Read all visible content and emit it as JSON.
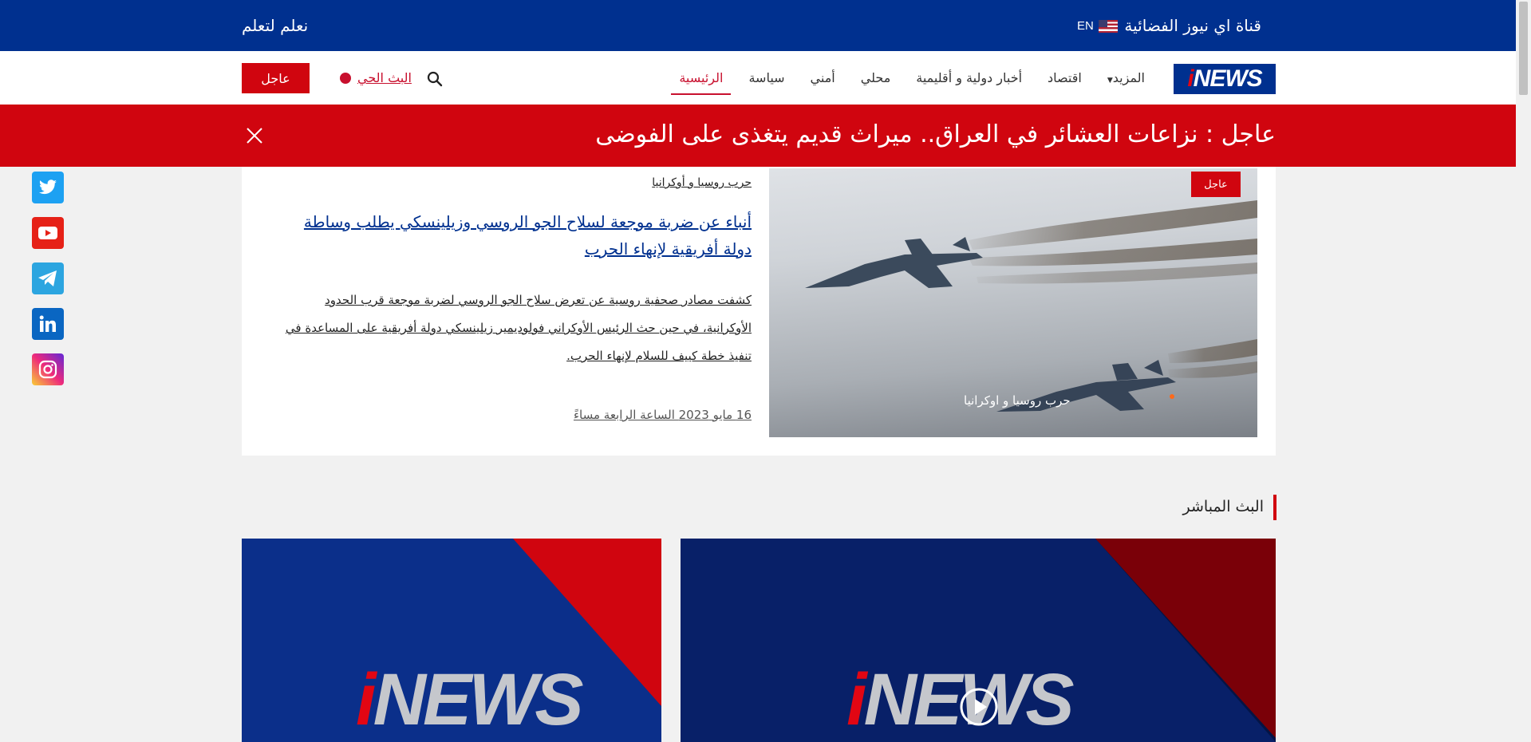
{
  "topbar": {
    "channel_name": "قناة اي نيوز الفضائية",
    "language": "EN",
    "slogan": "نعلم لتعلم"
  },
  "nav": {
    "logo_text_accent": "i",
    "logo_text": "NEWS",
    "items": [
      {
        "label": "الرئيسية",
        "active": true
      },
      {
        "label": "سياسة"
      },
      {
        "label": "أمني"
      },
      {
        "label": "محلي"
      },
      {
        "label": "أخبار دولية و أقليمية"
      },
      {
        "label": "اقتصاد"
      },
      {
        "label": "المزيد"
      }
    ],
    "live_label": "البث الحي",
    "urgent_label": "عاجل"
  },
  "breaking": {
    "text": "عاجل : نزاعات العشائر في العراق.. ميراث قديم يتغذى على الفوضى"
  },
  "social": [
    "twitter-icon",
    "youtube-icon",
    "telegram-icon",
    "linkedin-icon",
    "instagram-icon"
  ],
  "featured": {
    "tag": "عاجل",
    "image_caption": "حرب روسيا و اوكرانيا",
    "category": "حرب روسيا و أوكرانيا",
    "title": "أنباء عن ضربة موجعة لسلاح الجو الروسي وزيلينسكي يطلب وساطة دولة أفريقية لإنهاء الحرب",
    "description": "كشفت مصادر صحفية روسية عن تعرض سلاح الجو الروسي لضربة موجعة قرب الحدود الأوكرانية، في حين حث الرئيس الأوكراني فولوديمير زيلينسكي دولة أفريقية على المساعدة في تنفيذ خطة كييف للسلام لإنهاء الحرب.",
    "date": "16 مايو 2023 الساعة الرابعة مساءً"
  },
  "live_section": {
    "title": "البث المباشر"
  },
  "colors": {
    "brand_blue": "#00308f",
    "brand_red": "#d0050f"
  }
}
